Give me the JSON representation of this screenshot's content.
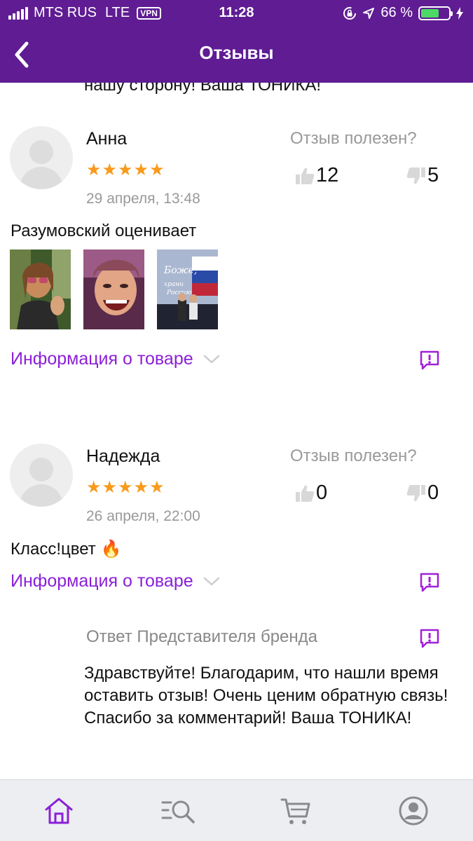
{
  "status_bar": {
    "carrier": "MTS RUS",
    "network": "LTE",
    "vpn": "VPN",
    "time": "11:28",
    "battery_percent": "66 %",
    "battery_level": 0.66,
    "icons": [
      "signal-icon",
      "rotation-lock-icon",
      "location-icon",
      "battery-icon",
      "charging-icon"
    ]
  },
  "header": {
    "title": "Отзывы",
    "back_icon": "chevron-left-icon"
  },
  "cut_off_text": "нашу сторону! Ваша ТОНИКА!",
  "reviews": [
    {
      "name": "Анна",
      "stars": "★★★★★",
      "rating": 5,
      "date": "29 апреля, 13:48",
      "useful_label": "Отзыв полезен?",
      "likes": "12",
      "dislikes": "5",
      "text": "Разумовский оценивает",
      "photos": [
        {
          "photo_text": ""
        },
        {
          "photo_text": ""
        },
        {
          "photo_text": "Боже, храни Россию"
        }
      ],
      "info_label": "Информация о товаре"
    },
    {
      "name": "Надежда",
      "stars": "★★★★★",
      "rating": 5,
      "date": "26 апреля, 22:00",
      "useful_label": "Отзыв полезен?",
      "likes": "0",
      "dislikes": "0",
      "text": "Класс!цвет 🔥",
      "info_label": "Информация о товаре",
      "brand_reply": {
        "title": "Ответ Представителя бренда",
        "text": "Здравствуйте! Благодарим, что нашли время оставить отзыв! Очень ценим обратную связь!  Спасибо за комментарий! Ваша ТОНИКА!"
      }
    }
  ],
  "tabbar": {
    "tabs": [
      "home-icon",
      "search-catalog-icon",
      "cart-icon",
      "profile-icon"
    ],
    "active": "home-icon"
  },
  "colors": {
    "brand": "#5f1c93",
    "accent": "#8b20d8",
    "stars": "#f89a1c",
    "muted": "#999999"
  }
}
